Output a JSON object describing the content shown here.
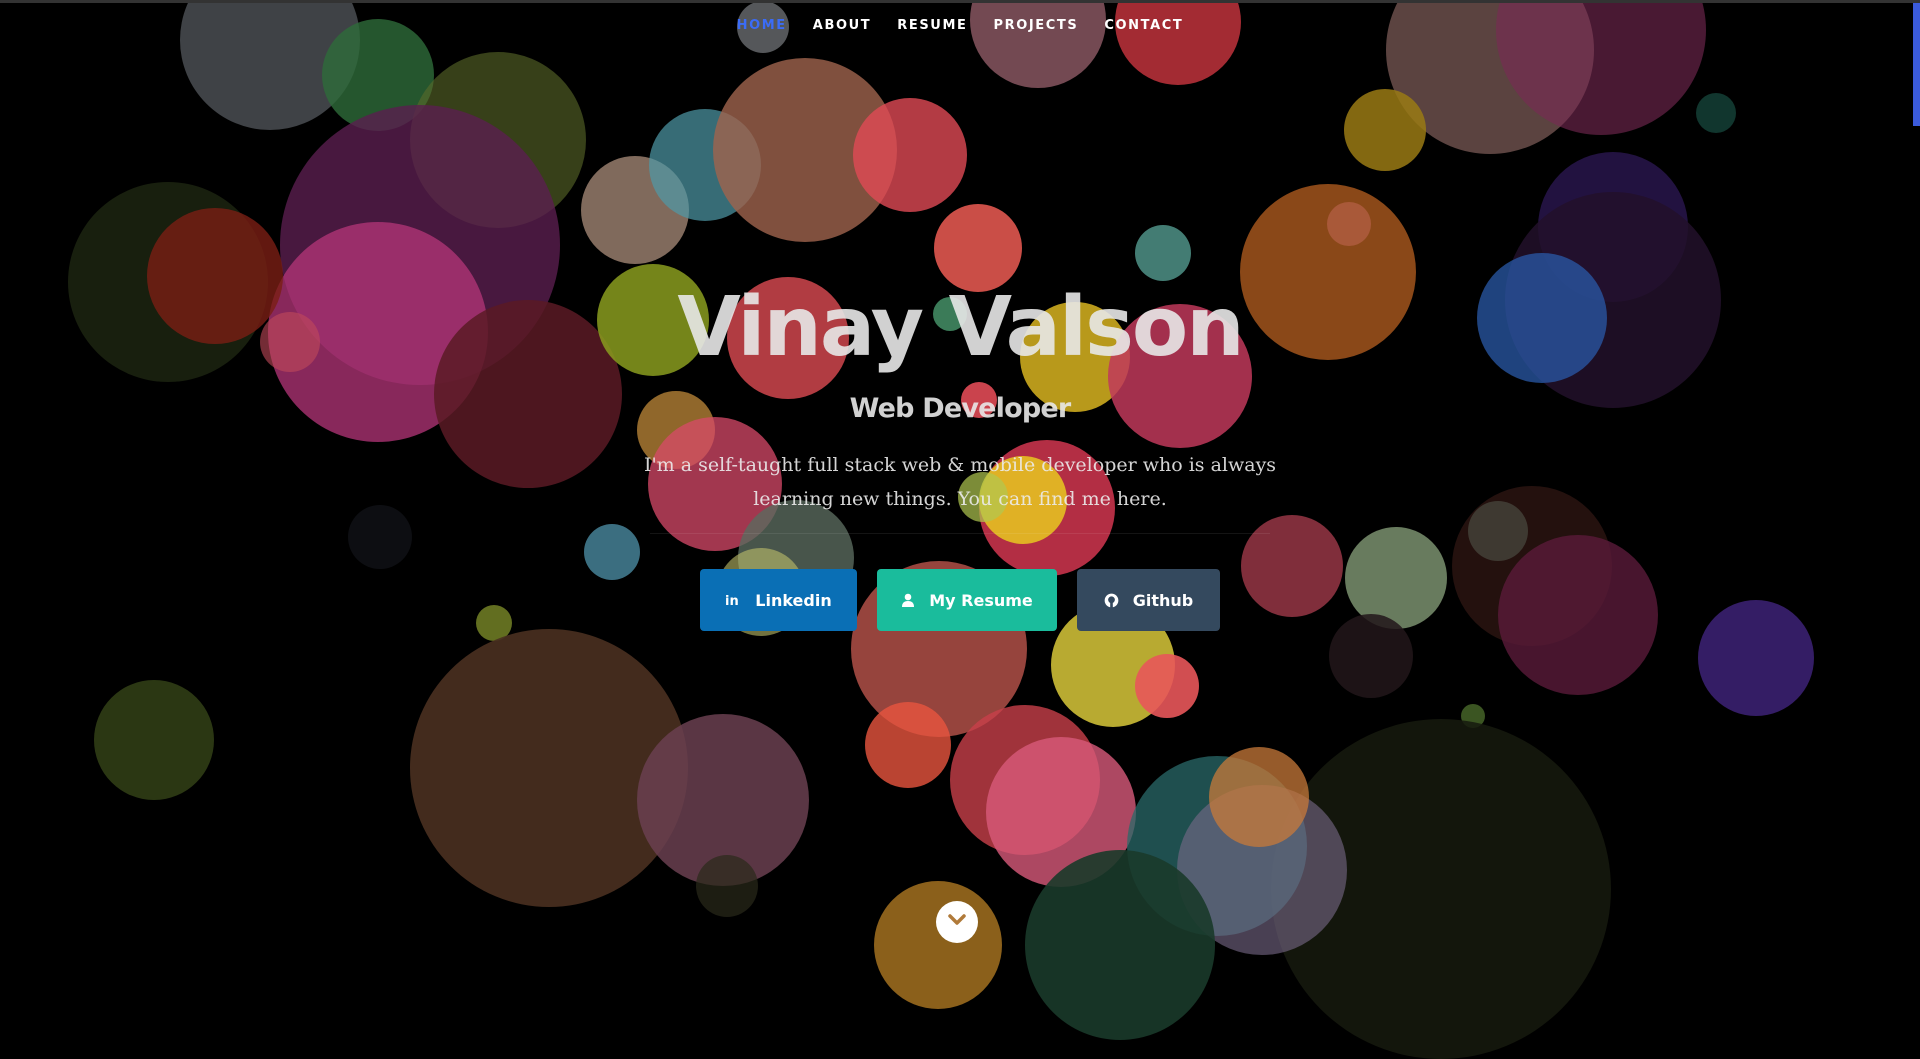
{
  "nav": {
    "items": [
      {
        "label": "HOME",
        "active": true
      },
      {
        "label": "ABOUT"
      },
      {
        "label": "RESUME"
      },
      {
        "label": "PROJECTS"
      },
      {
        "label": "CONTACT"
      }
    ]
  },
  "hero": {
    "name": "Vinay Valson",
    "role": "Web Developer",
    "description": "I'm a self-taught full stack web & mobile developer who is always learning new things. You can find me here."
  },
  "buttons": {
    "linkedin": {
      "label": "Linkedin",
      "icon": "linkedin-icon",
      "color": "#0a6fb5"
    },
    "resume": {
      "label": "My Resume",
      "icon": "user-icon",
      "color": "#1abc9c"
    },
    "github": {
      "label": "Github",
      "icon": "github-icon",
      "color": "#34495e"
    }
  },
  "colors": {
    "nav_active": "#3b6cf7",
    "background": "#000000"
  }
}
